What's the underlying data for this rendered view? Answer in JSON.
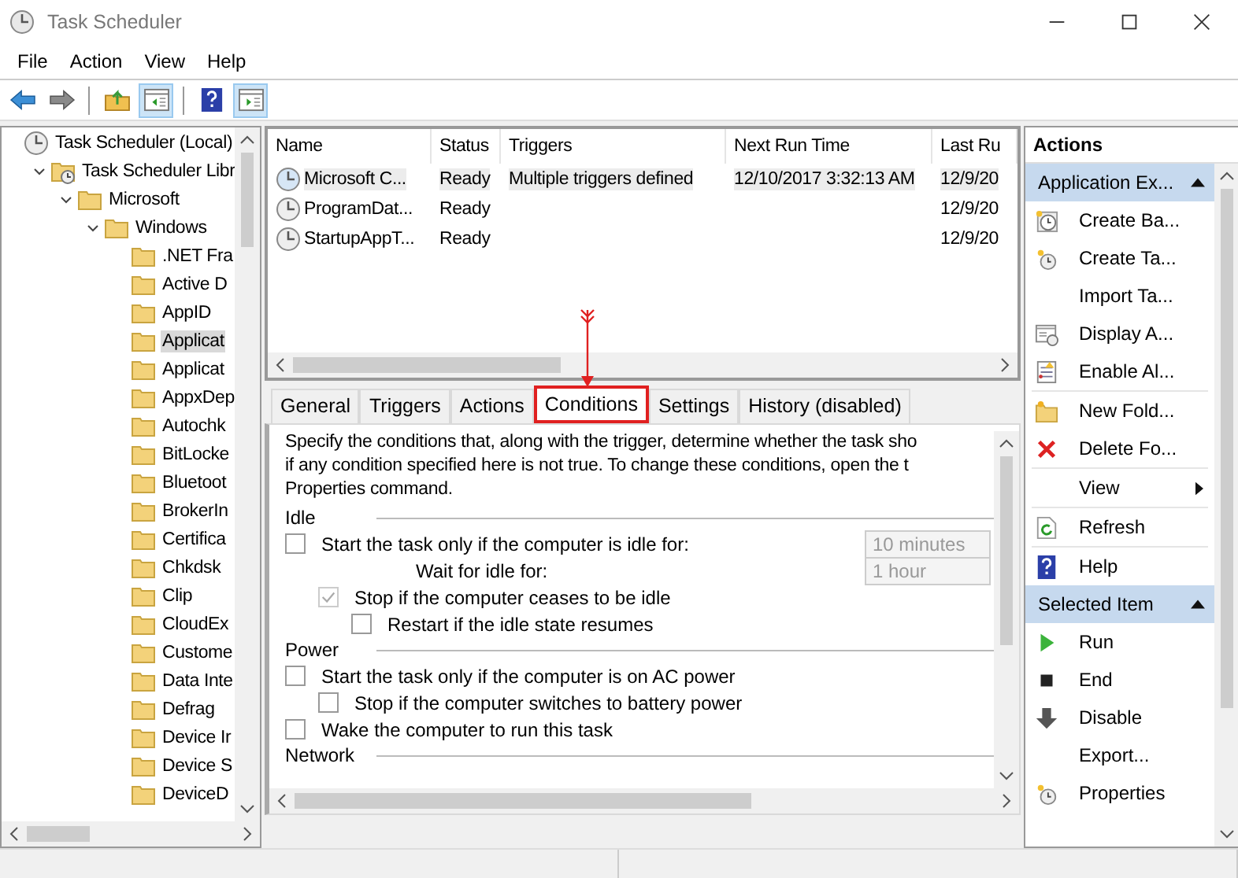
{
  "window": {
    "title": "Task Scheduler"
  },
  "menu": [
    "File",
    "Action",
    "View",
    "Help"
  ],
  "toolbar": [
    {
      "pressed": false
    },
    {
      "pressed": false
    },
    {
      "pressed": false
    },
    {
      "pressed": true
    },
    {
      "pressed": false
    },
    {
      "pressed": true
    }
  ],
  "tree": [
    {
      "label": "Task Scheduler (Local)",
      "selected": false,
      "children": [
        {
          "label": "Task Scheduler Libr",
          "selected": false,
          "expanded": true,
          "children": [
            {
              "label": "Microsoft",
              "selected": false,
              "expanded": true,
              "children": [
                {
                  "label": "Windows",
                  "selected": false,
                  "expanded": true,
                  "children": [
                    {
                      "label": ".NET Fra",
                      "selected": false
                    },
                    {
                      "label": "Active D",
                      "selected": false
                    },
                    {
                      "label": "AppID",
                      "selected": false
                    },
                    {
                      "label": "Applicat",
                      "selected": true
                    },
                    {
                      "label": "Applicat",
                      "selected": false
                    },
                    {
                      "label": "AppxDep",
                      "selected": false
                    },
                    {
                      "label": "Autochk",
                      "selected": false
                    },
                    {
                      "label": "BitLocke",
                      "selected": false
                    },
                    {
                      "label": "Bluetoot",
                      "selected": false
                    },
                    {
                      "label": "BrokerIn",
                      "selected": false
                    },
                    {
                      "label": "Certifica",
                      "selected": false
                    },
                    {
                      "label": "Chkdsk",
                      "selected": false
                    },
                    {
                      "label": "Clip",
                      "selected": false
                    },
                    {
                      "label": "CloudEx",
                      "selected": false
                    },
                    {
                      "label": "Custome",
                      "selected": false
                    },
                    {
                      "label": "Data Inte",
                      "selected": false
                    },
                    {
                      "label": "Defrag",
                      "selected": false
                    },
                    {
                      "label": "Device Ir",
                      "selected": false
                    },
                    {
                      "label": "Device S",
                      "selected": false
                    },
                    {
                      "label": "DeviceD",
                      "selected": false
                    }
                  ]
                }
              ]
            }
          ]
        }
      ]
    }
  ],
  "table": {
    "columns": [
      "Name",
      "Status",
      "Triggers",
      "Next Run Time",
      "Last Ru"
    ],
    "rows": [
      {
        "selected": true,
        "cells": [
          "Microsoft C...",
          "Ready",
          "Multiple triggers defined",
          "12/10/2017 3:32:13 AM",
          "12/9/20"
        ]
      },
      {
        "selected": false,
        "cells": [
          "ProgramDat...",
          "Ready",
          "",
          "",
          "12/9/20"
        ]
      },
      {
        "selected": false,
        "cells": [
          "StartupAppT...",
          "Ready",
          "",
          "",
          "12/9/20"
        ]
      }
    ]
  },
  "tabs": [
    {
      "label": "General",
      "selected": false,
      "highlighted": false
    },
    {
      "label": "Triggers",
      "selected": false,
      "highlighted": false
    },
    {
      "label": "Actions",
      "selected": false,
      "highlighted": false
    },
    {
      "label": "Conditions",
      "selected": true,
      "highlighted": true
    },
    {
      "label": "Settings",
      "selected": false,
      "highlighted": false
    },
    {
      "label": "History (disabled)",
      "selected": false,
      "highlighted": false
    }
  ],
  "conditions": {
    "description_lines": [
      "Specify the conditions that, along with the trigger, determine whether the task sho",
      "if any condition specified here is not true.  To change these conditions, open the t",
      "Properties command."
    ],
    "sections": [
      {
        "title": "Idle",
        "items": [
          {
            "kind": "checkbox",
            "label": "Start the task only if the computer is idle for:",
            "checked": false,
            "disabled": false,
            "field": {
              "value": "10 minutes",
              "disabled": true
            },
            "children": [
              {
                "kind": "label",
                "label": "Wait for idle for:",
                "field": {
                  "value": "1 hour",
                  "disabled": true
                }
              },
              {
                "kind": "checkbox",
                "label": "Stop if the computer ceases to be idle",
                "checked": true,
                "disabled": true,
                "children": [
                  {
                    "kind": "checkbox",
                    "label": "Restart if the idle state resumes",
                    "checked": false,
                    "disabled": false
                  }
                ]
              }
            ]
          }
        ]
      },
      {
        "title": "Power",
        "items": [
          {
            "kind": "checkbox",
            "label": "Start the task only if the computer is on AC power",
            "checked": false,
            "disabled": false,
            "children": [
              {
                "kind": "checkbox",
                "label": "Stop if the computer switches to battery power",
                "checked": false,
                "disabled": false
              }
            ]
          },
          {
            "kind": "checkbox",
            "label": "Wake the computer to run this task",
            "checked": false,
            "disabled": false
          }
        ]
      },
      {
        "title": "Network"
      }
    ]
  },
  "actions": {
    "title": "Actions",
    "sections": [
      {
        "title": "Application Ex...",
        "groups": [
          [
            {
              "label": "Create Ba...",
              "submenu": false
            },
            {
              "label": "Create Ta...",
              "submenu": false
            },
            {
              "label": "Import Ta...",
              "submenu": false
            },
            {
              "label": "Display A...",
              "submenu": false
            },
            {
              "label": "Enable Al...",
              "submenu": false
            }
          ],
          [
            {
              "label": "New Fold...",
              "submenu": false
            },
            {
              "label": "Delete Fo...",
              "submenu": false
            }
          ],
          [
            {
              "label": "View",
              "submenu": true
            }
          ],
          [
            {
              "label": "Refresh",
              "submenu": false
            }
          ],
          [
            {
              "label": "Help",
              "submenu": false
            }
          ]
        ]
      },
      {
        "title": "Selected Item",
        "groups": [
          [
            {
              "label": "Run",
              "submenu": false
            },
            {
              "label": "End",
              "submenu": false
            },
            {
              "label": "Disable",
              "submenu": false
            },
            {
              "label": "Export...",
              "submenu": false
            },
            {
              "label": "Properties",
              "submenu": false
            }
          ]
        ]
      }
    ]
  }
}
